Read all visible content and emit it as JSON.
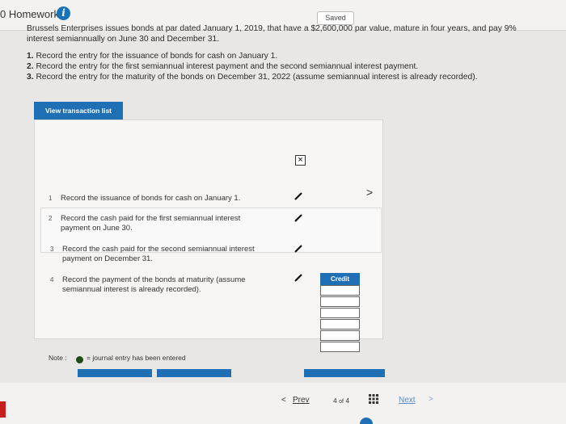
{
  "header": {
    "title": "0 Homework 1",
    "info_icon": "info-icon",
    "saved": "Saved"
  },
  "problem": {
    "text": "Brussels Enterprises issues bonds at par dated January 1, 2019, that have a $2,600,000 par value, mature in four years, and pay 9% interest semiannually on June 30 and December 31.",
    "requirements": [
      {
        "num": "1.",
        "text": "Record the entry for the issuance of bonds for cash on January 1."
      },
      {
        "num": "2.",
        "text": "Record the entry for the first semiannual interest payment and the second semiannual interest payment."
      },
      {
        "num": "3.",
        "text": "Record the entry for the maturity of the bonds on December 31, 2022 (assume semiannual interest is already recorded)."
      }
    ]
  },
  "panel": {
    "view_button": "View transaction list",
    "close": "×",
    "transactions": [
      {
        "num": "1",
        "text": "Record the issuance of bonds for cash on January 1."
      },
      {
        "num": "2",
        "text": "Record the cash paid for the first semiannual interest payment on June 30."
      },
      {
        "num": "3",
        "text": "Record the cash paid for the second semiannual interest payment on December 31."
      },
      {
        "num": "4",
        "text": "Record the payment of the bonds at maturity (assume semiannual interest is already recorded)."
      }
    ],
    "credit_header": "Credit",
    "note_label": "Note :",
    "note_text": "= journal entry has been entered",
    "chevron": ">"
  },
  "footer": {
    "prev": "Prev",
    "page_current": "4",
    "page_of": "of",
    "page_total": "4",
    "next": "Next"
  },
  "colors": {
    "accent": "#1f6fb5",
    "entered_dot": "#1e4d18"
  }
}
